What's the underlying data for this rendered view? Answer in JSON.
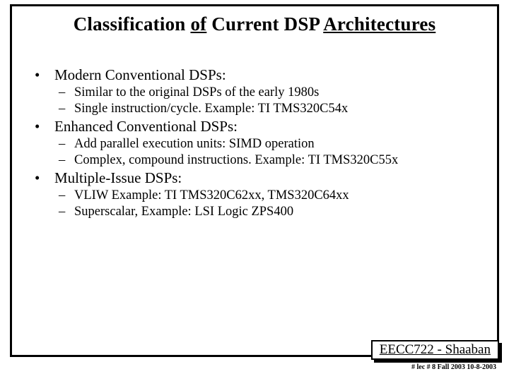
{
  "title_pre": "Classification ",
  "title_u1": "of",
  "title_mid": " Current DSP ",
  "title_u2": "Architectures",
  "bullets": {
    "b1": "Modern Conventional DSPs:",
    "b1a": "Similar to the original DSPs of the early 1980s",
    "b1b": "Single instruction/cycle.  Example:  TI TMS320C54x",
    "b2": "Enhanced Conventional DSPs:",
    "b2a": "Add parallel execution units:  SIMD operation",
    "b2b": "Complex, compound instructions.  Example:  TI TMS320C55x",
    "b3": "Multiple-Issue DSPs:",
    "b3a": "VLIW  Example:   TI TMS320C62xx, TMS320C64xx",
    "b3b": "Superscalar,  Example:  LSI Logic ZPS400"
  },
  "footer_course": "EECC722 - ",
  "footer_name": "Shaaban",
  "subfooter": "#  lec # 8    Fall 2003    10-8-2003"
}
